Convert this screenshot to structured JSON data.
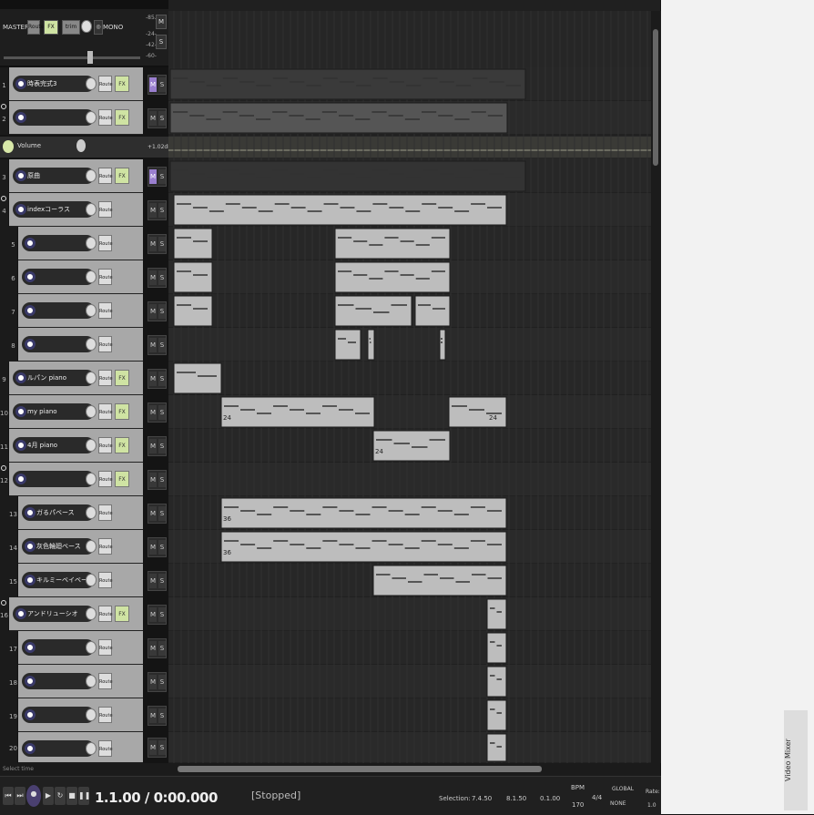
{
  "master": {
    "label": "MASTER",
    "route": "Route",
    "fx": "FX",
    "trim": "trim",
    "mono": "MONO",
    "meter_top": "-85.6",
    "meter_mid1": "-24-",
    "meter_mid2": "-42-",
    "meter_bot": "-60-",
    "mute": "M",
    "solo": "S"
  },
  "envelope": {
    "name": "Volume",
    "value": "+1.02dB"
  },
  "tracks": [
    {
      "n": "1",
      "name": "時表完式3"
    },
    {
      "n": "2",
      "name": ""
    },
    {
      "n": "3",
      "name": "原曲"
    },
    {
      "n": "4",
      "name": "indexコーラス"
    },
    {
      "n": "5",
      "name": ""
    },
    {
      "n": "6",
      "name": ""
    },
    {
      "n": "7",
      "name": ""
    },
    {
      "n": "8",
      "name": ""
    },
    {
      "n": "9",
      "name": "ルパン piano"
    },
    {
      "n": "10",
      "name": "my piano"
    },
    {
      "n": "11",
      "name": "4月 piano"
    },
    {
      "n": "12",
      "name": ""
    },
    {
      "n": "13",
      "name": "ガるパベース"
    },
    {
      "n": "14",
      "name": "灰色輪廻ベース"
    },
    {
      "n": "15",
      "name": "キルミーベイベー系ベース"
    },
    {
      "n": "16",
      "name": "アンドリューシオ"
    },
    {
      "n": "17",
      "name": ""
    },
    {
      "n": "18",
      "name": ""
    },
    {
      "n": "19",
      "name": ""
    },
    {
      "n": "20",
      "name": ""
    }
  ],
  "labels": {
    "route": "Route",
    "fx": "FX",
    "m": "M",
    "s": "S"
  },
  "item_labels": {
    "a": "24",
    "b": "24",
    "c": "24",
    "d": "36",
    "e": "36"
  },
  "status": {
    "hint": "Select time"
  },
  "transport": {
    "time": "1.1.00 / 0:00.000",
    "state": "[Stopped]",
    "selection_label": "Selection:",
    "sel_start": "7.4.50",
    "sel_end": "8.1.50",
    "sel_len": "0.1.00",
    "bpm_label": "BPM",
    "bpm": "170",
    "sig": "4/4",
    "global": "GLOBAL",
    "none": "NONE",
    "rate_label": "Rate:",
    "rate": "1.0"
  },
  "sidepanel": {
    "tab": "Video Mixer"
  }
}
